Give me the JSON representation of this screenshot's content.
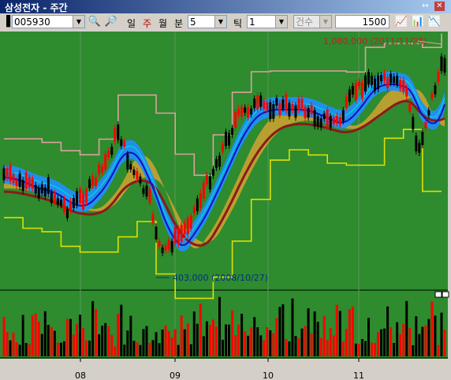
{
  "window": {
    "title": "삼성전자 - 주간",
    "buttons": {
      "link": "↔",
      "close": "✕"
    }
  },
  "toolbar": {
    "code": "005930",
    "period_labels": [
      "일",
      "주",
      "월",
      "분"
    ],
    "minute_value": "5",
    "tick_label": "틱",
    "tick_value": "1",
    "count_label": "건수",
    "count_value": "1500"
  },
  "chart_data": {
    "type": "candlestick",
    "annotations": {
      "high": "1,080,000 (2011/11/28)",
      "low": "403,000 (2008/10/27)"
    },
    "x_tick_labels": [
      "08",
      "09",
      "10",
      "11"
    ],
    "colors": {
      "background": "#2e8b2e",
      "up": "#ff0000",
      "down": "#000000",
      "cloud_fill": "#b8a030",
      "band_fill": "#1e90ff",
      "envelope_upper": "#e0a0a0",
      "envelope_lower": "#e0e000",
      "ma_dark": "#8b1a1a"
    }
  }
}
